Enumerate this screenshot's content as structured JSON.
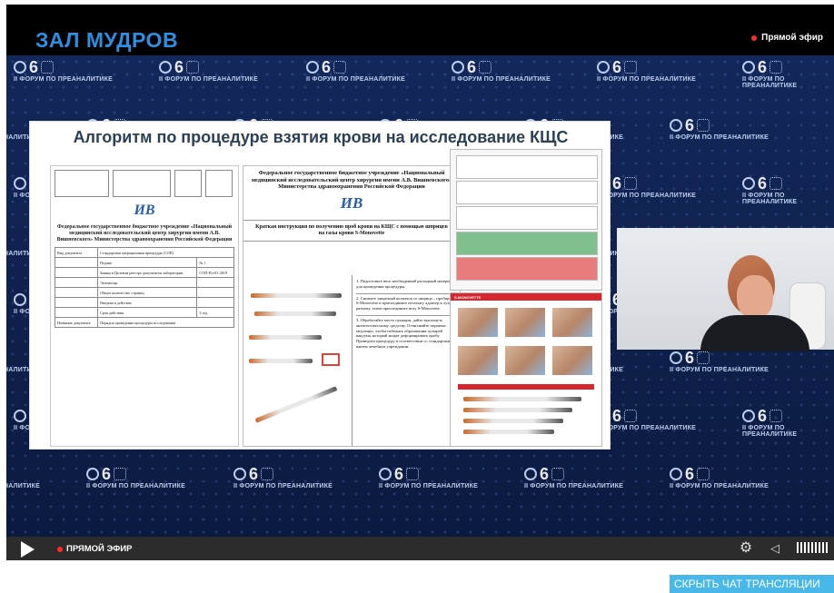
{
  "header": {
    "hall_title": "ЗАЛ МУДРОВ",
    "live_label": "Прямой эфир"
  },
  "backdrop": {
    "forum_label": "II ФОРУМ ПО ПРЕАНАЛИТИКЕ",
    "congress_number": "6"
  },
  "slide": {
    "title": "Алгоритм по процедуре взятия крови на исследование КЩС",
    "doc1": {
      "logo": "ИВ",
      "institution": "Федеральное государственное бюджетное учреждение «Национальный медицинский исследовательский центр хирургии имени А.В. Вишневского» Министерства здравоохранения Российской Федерации",
      "rows": [
        [
          "Вид документа",
          "Стандартная операционная процедура (СОП)"
        ],
        [
          "",
          "Подано",
          "№ 1"
        ],
        [
          "",
          "Заявка в Целевом реестре документов лаборатории",
          "СОП-Пл-01-2019"
        ],
        [
          "",
          "Экземпляр",
          ""
        ],
        [
          "",
          "Общее количество страниц",
          ""
        ],
        [
          "",
          "Введена в действие",
          ""
        ],
        [
          "",
          "Срок действия",
          "3 год"
        ],
        [
          "Название документа",
          "Порядок проведения процедуры исследования"
        ]
      ]
    },
    "doc2": {
      "organization": "Федеральное государственное бюджетное учреждение «Национальный медицинский исследовательский центр хирургии имени А.В. Вишневского» Министерства здравоохранения Российской Федерации",
      "logo": "ИВ",
      "brief_title": "Краткая инструкция по получению проб крови на КЩС с помощью шприцев на газы крови S-Monovette",
      "steps": [
        "1. Подготовьте весь необходимый расходный материал для проведения процедуры.",
        "2. Снимите защитный колпачок со шприца – пробирки S-Monovette и присоедините necessary адаптер к луэр-разъему, затем присоедините иглу S-Monovette.",
        "3. Обработайте место пункции, дайте высохнуть антисептическому средству. Оттягивайте поршень медленно, чтобы избежать образования пузырей вакуума, который может деформировать пробу. Проведите процедуру в соответствии со стандартами в вашем лечебном учреждении."
      ]
    },
    "doc4": {
      "banner": "S-MONOVETTE"
    }
  },
  "player": {
    "live_label": "ПРЯМОЙ ЭФИР",
    "settings_icon": "gear-icon",
    "volume_icon": "volume-icon"
  },
  "chat": {
    "hide_button": "СКРЫТЬ ЧАТ ТРАНСЛЯЦИИ"
  },
  "colors": {
    "accent": "#2e8fe0",
    "live_dot": "#ff2a2a",
    "chat_button": "#48b8e8",
    "backdrop": "#13285a"
  }
}
